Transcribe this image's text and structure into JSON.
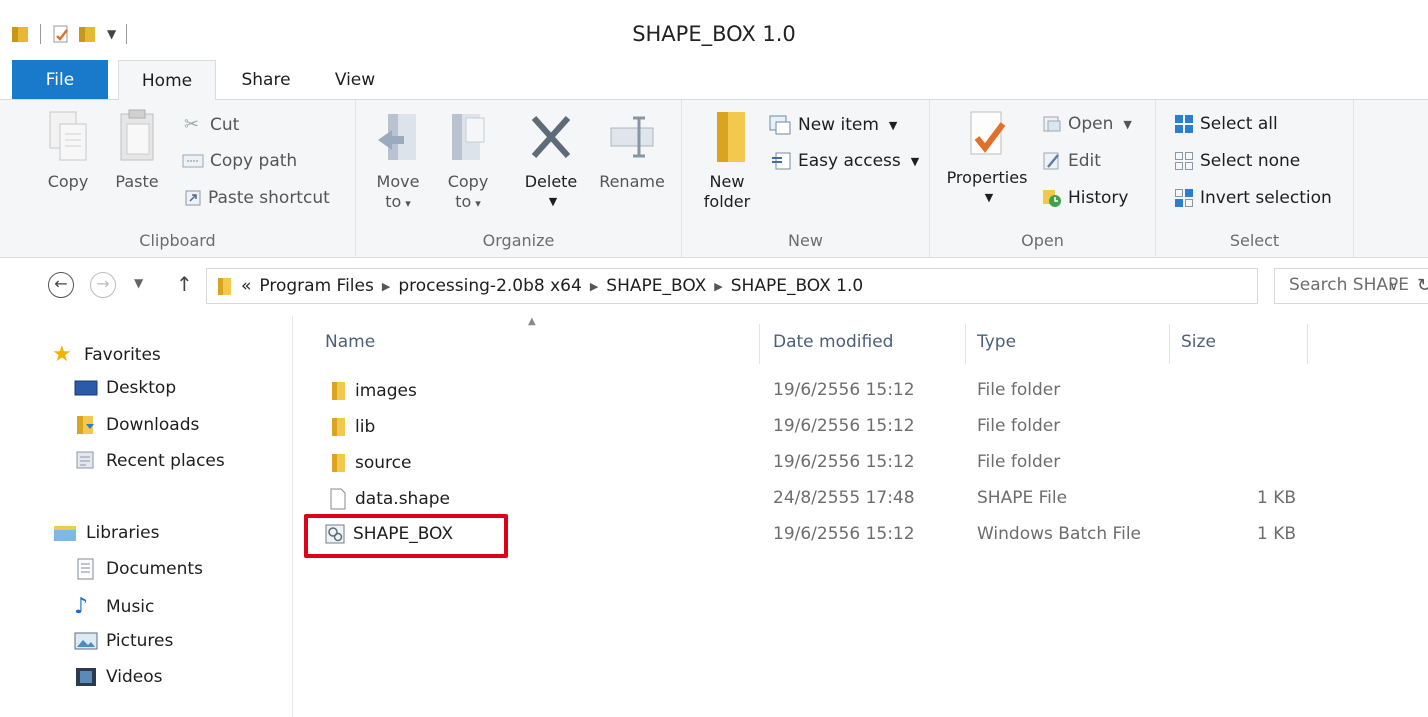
{
  "window": {
    "title": "SHAPE_BOX 1.0"
  },
  "ribbon_tabs": [
    "File",
    "Home",
    "Share",
    "View"
  ],
  "ribbon": {
    "clipboard": {
      "label": "Clipboard",
      "copy": "Copy",
      "paste": "Paste",
      "cut": "Cut",
      "copy_path": "Copy path",
      "paste_shortcut": "Paste shortcut"
    },
    "organize": {
      "label": "Organize",
      "move_to_1": "Move",
      "move_to_2": "to",
      "copy_to_1": "Copy",
      "copy_to_2": "to",
      "delete": "Delete",
      "rename": "Rename"
    },
    "new": {
      "label": "New",
      "new_folder_1": "New",
      "new_folder_2": "folder",
      "new_item": "New item",
      "easy_access": "Easy access"
    },
    "open": {
      "label": "Open",
      "properties": "Properties",
      "open": "Open",
      "edit": "Edit",
      "history": "History"
    },
    "select": {
      "label": "Select",
      "select_all": "Select all",
      "select_none": "Select none",
      "invert_selection": "Invert selection"
    }
  },
  "address": {
    "overflow": "«",
    "crumbs": [
      "Program Files",
      "processing-2.0b8 x64",
      "SHAPE_BOX",
      "SHAPE_BOX 1.0"
    ],
    "search_placeholder": "Search SHAPE"
  },
  "nav": {
    "favorites": "Favorites",
    "favorites_items": [
      "Desktop",
      "Downloads",
      "Recent places"
    ],
    "libraries": "Libraries",
    "libraries_items": [
      "Documents",
      "Music",
      "Pictures",
      "Videos"
    ]
  },
  "columns": {
    "name": "Name",
    "date": "Date modified",
    "type": "Type",
    "size": "Size"
  },
  "files": [
    {
      "name": "images",
      "date": "19/6/2556 15:12",
      "type": "File folder",
      "size": "",
      "icon": "folder-icon"
    },
    {
      "name": "lib",
      "date": "19/6/2556 15:12",
      "type": "File folder",
      "size": "",
      "icon": "folder-icon"
    },
    {
      "name": "source",
      "date": "19/6/2556 15:12",
      "type": "File folder",
      "size": "",
      "icon": "folder-icon"
    },
    {
      "name": "data.shape",
      "date": "24/8/2555 17:48",
      "type": "SHAPE File",
      "size": "1 KB",
      "icon": "file-icon"
    },
    {
      "name": "SHAPE_BOX",
      "date": "19/6/2556 15:12",
      "type": "Windows Batch File",
      "size": "1 KB",
      "icon": "batch-file-icon"
    }
  ],
  "colors": {
    "accent": "#1979ca",
    "highlight": "#e0001a",
    "folder": "#e8b830"
  }
}
